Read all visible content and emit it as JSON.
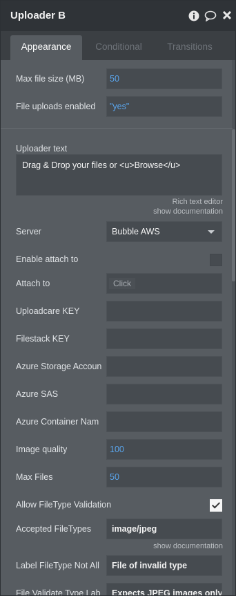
{
  "window": {
    "title": "Uploader B"
  },
  "tabs": [
    {
      "label": "Appearance"
    },
    {
      "label": "Conditional"
    },
    {
      "label": "Transitions"
    }
  ],
  "fields": {
    "max_file_size": {
      "label": "Max file size (MB)",
      "value": "50"
    },
    "file_uploads_enabled": {
      "label": "File uploads enabled",
      "value": "\"yes\""
    },
    "uploader_text": {
      "label": "Uploader text",
      "value": "Drag & Drop your files or <u>Browse</u>",
      "hint": "Rich text editor",
      "doc_link": "show documentation"
    },
    "server": {
      "label": "Server",
      "value": "Bubble AWS"
    },
    "enable_attach_to": {
      "label": "Enable attach to",
      "checked": false
    },
    "attach_to": {
      "label": "Attach to",
      "button": "Click"
    },
    "uploadcare_key": {
      "label": "Uploadcare KEY",
      "value": ""
    },
    "filestack_key": {
      "label": "Filestack KEY",
      "value": ""
    },
    "azure_storage_account": {
      "label": "Azure Storage Accoun",
      "value": ""
    },
    "azure_sas": {
      "label": "Azure SAS",
      "value": ""
    },
    "azure_container_name": {
      "label": "Azure Container Nam",
      "value": ""
    },
    "image_quality": {
      "label": "Image quality",
      "value": "100"
    },
    "max_files": {
      "label": "Max Files",
      "value": "50"
    },
    "allow_filetype_validation": {
      "label": "Allow FileType Validation",
      "checked": true
    },
    "accepted_filetypes": {
      "label": "Accepted FileTypes",
      "value": "image/jpeg",
      "doc_link": "show documentation"
    },
    "label_filetype_not_allowed": {
      "label": "Label FileType Not All",
      "value": "File of invalid type"
    },
    "file_validate_type_label": {
      "label": "File Validate Type Lab",
      "value": "Expects JPEG images only"
    }
  },
  "colors": {
    "accent": "#5aa5ec",
    "panel": "#575c61",
    "titlebar": "#2f3337"
  }
}
